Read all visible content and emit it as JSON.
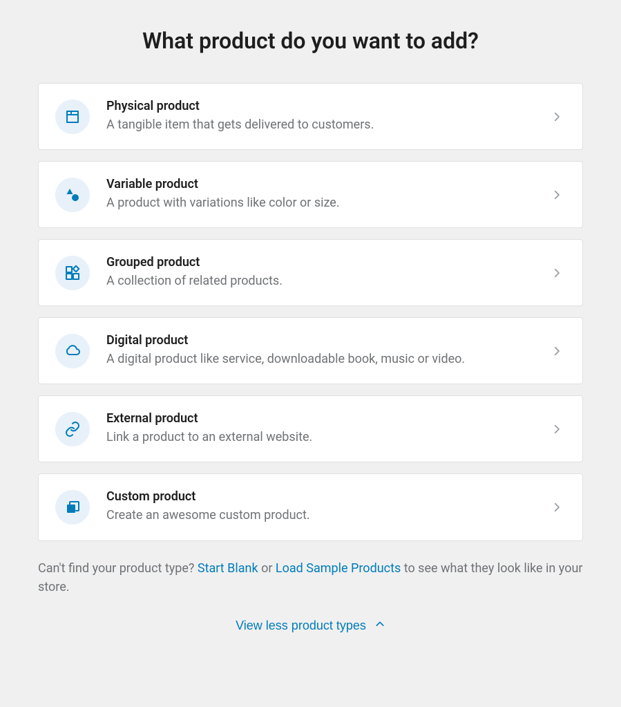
{
  "heading": "What product do you want to add?",
  "products": [
    {
      "icon": "box",
      "title": "Physical product",
      "desc": "A tangible item that gets delivered to customers."
    },
    {
      "icon": "shapes",
      "title": "Variable product",
      "desc": "A product with variations like color or size."
    },
    {
      "icon": "grid",
      "title": "Grouped product",
      "desc": "A collection of related products."
    },
    {
      "icon": "cloud",
      "title": "Digital product",
      "desc": "A digital product like service, downloadable book, music or video."
    },
    {
      "icon": "link",
      "title": "External product",
      "desc": "Link a product to an external website."
    },
    {
      "icon": "copy",
      "title": "Custom product",
      "desc": "Create an awesome custom product."
    }
  ],
  "helper": {
    "prefix": "Can't find your product type? ",
    "link1": "Start Blank",
    "middle": " or ",
    "link2": "Load Sample Products",
    "suffix": " to see what they look like in your store."
  },
  "toggle_label": "View less product types",
  "colors": {
    "accent": "#007cba",
    "icon_bg": "#e8f1fa",
    "text": "#1e1e1e",
    "muted": "#6f7275",
    "border": "#e0e0e0",
    "page_bg": "#f0f0f1"
  }
}
